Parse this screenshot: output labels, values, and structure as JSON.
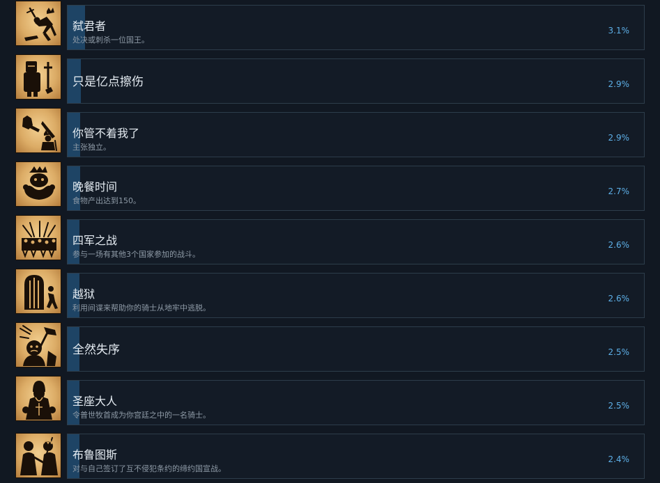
{
  "achievements": [
    {
      "title": "弑君者",
      "description": "处决或刺杀一位国王。",
      "percent": "3.1%",
      "unlock_rate": 3.1,
      "icon": "regicide-icon"
    },
    {
      "title": "只是亿点擦伤",
      "description": "",
      "percent": "2.9%",
      "unlock_rate": 2.9,
      "icon": "black-knight-icon"
    },
    {
      "title": "你管不着我了",
      "description": "主张独立。",
      "percent": "2.9%",
      "unlock_rate": 2.9,
      "icon": "independence-icon"
    },
    {
      "title": "晚餐时间",
      "description": "食物产出达到150。",
      "percent": "2.7%",
      "unlock_rate": 2.7,
      "icon": "feast-icon"
    },
    {
      "title": "四军之战",
      "description": "参与一场有其他3个国家参加的战斗。",
      "percent": "2.6%",
      "unlock_rate": 2.6,
      "icon": "battle-icon"
    },
    {
      "title": "越狱",
      "description": "利用间谍来帮助你的骑士从地牢中逃脱。",
      "percent": "2.6%",
      "unlock_rate": 2.6,
      "icon": "jailbreak-icon"
    },
    {
      "title": "全然失序",
      "description": "",
      "percent": "2.5%",
      "unlock_rate": 2.5,
      "icon": "chaos-icon"
    },
    {
      "title": "圣座大人",
      "description": "令普世牧首成为你宫廷之中的一名骑士。",
      "percent": "2.5%",
      "unlock_rate": 2.5,
      "icon": "patriarch-icon"
    },
    {
      "title": "布鲁图斯",
      "description": "对与自己签订了互不侵犯条约的缔约国宣战。",
      "percent": "2.4%",
      "unlock_rate": 2.4,
      "icon": "brutus-icon"
    }
  ],
  "colors": {
    "background": "#111822",
    "panel": "#131b26",
    "panel_border": "#2d3d4b",
    "progress_fill": "#1e4465",
    "title_text": "#e4ebf1",
    "description_text": "#8e9aa6",
    "percent_text": "#5eb0e8",
    "icon_parchment": "#dcac66",
    "icon_ink": "#1a1008"
  }
}
